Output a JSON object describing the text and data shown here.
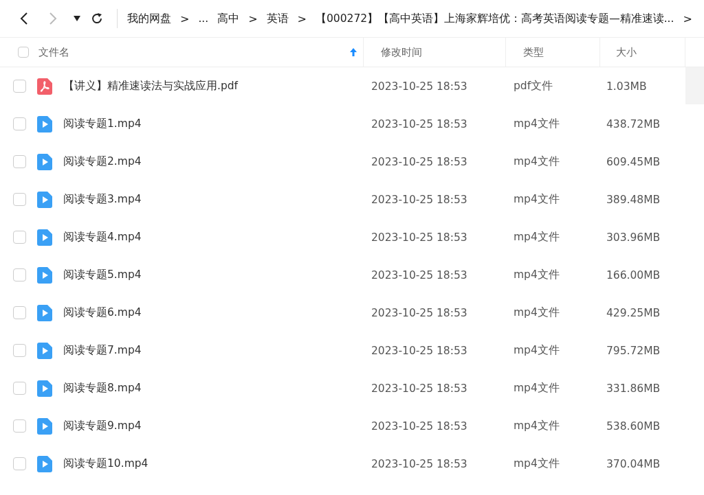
{
  "toolbar": {
    "back": {
      "disabled": false
    },
    "forward": {
      "disabled": true
    },
    "breadcrumbs": [
      {
        "label": "我的网盘",
        "kind": "crumb"
      },
      {
        "label": "...",
        "kind": "ellipsis"
      },
      {
        "label": "高中",
        "kind": "crumb"
      },
      {
        "label": "英语",
        "kind": "crumb"
      },
      {
        "label": "【000272】【高中英语】上海家辉培优：高考英语阅读专题—精准速读...",
        "kind": "crumb"
      }
    ],
    "separator": ">"
  },
  "table": {
    "select_all": {
      "checked": false
    },
    "columns": [
      {
        "label": "文件名",
        "sorted": true
      },
      {
        "label": "修改时间",
        "sorted": false
      },
      {
        "label": "类型",
        "sorted": false
      },
      {
        "label": "大小",
        "sorted": false
      }
    ],
    "rows": [
      {
        "kind": "pdf",
        "checked": false,
        "name": "【讲义】精准速读法与实战应用.pdf",
        "modified": "2023-10-25 18:53",
        "type": "pdf文件",
        "size": "1.03MB"
      },
      {
        "kind": "video",
        "checked": false,
        "name": "阅读专题1.mp4",
        "modified": "2023-10-25 18:53",
        "type": "mp4文件",
        "size": "438.72MB"
      },
      {
        "kind": "video",
        "checked": false,
        "name": "阅读专题2.mp4",
        "modified": "2023-10-25 18:53",
        "type": "mp4文件",
        "size": "609.45MB"
      },
      {
        "kind": "video",
        "checked": false,
        "name": "阅读专题3.mp4",
        "modified": "2023-10-25 18:53",
        "type": "mp4文件",
        "size": "389.48MB"
      },
      {
        "kind": "video",
        "checked": false,
        "name": "阅读专题4.mp4",
        "modified": "2023-10-25 18:53",
        "type": "mp4文件",
        "size": "303.96MB"
      },
      {
        "kind": "video",
        "checked": false,
        "name": "阅读专题5.mp4",
        "modified": "2023-10-25 18:53",
        "type": "mp4文件",
        "size": "166.00MB"
      },
      {
        "kind": "video",
        "checked": false,
        "name": "阅读专题6.mp4",
        "modified": "2023-10-25 18:53",
        "type": "mp4文件",
        "size": "429.25MB"
      },
      {
        "kind": "video",
        "checked": false,
        "name": "阅读专题7.mp4",
        "modified": "2023-10-25 18:53",
        "type": "mp4文件",
        "size": "795.72MB"
      },
      {
        "kind": "video",
        "checked": false,
        "name": "阅读专题8.mp4",
        "modified": "2023-10-25 18:53",
        "type": "mp4文件",
        "size": "331.86MB"
      },
      {
        "kind": "video",
        "checked": false,
        "name": "阅读专题9.mp4",
        "modified": "2023-10-25 18:53",
        "type": "mp4文件",
        "size": "538.60MB"
      },
      {
        "kind": "video",
        "checked": false,
        "name": "阅读专题10.mp4",
        "modified": "2023-10-25 18:53",
        "type": "mp4文件",
        "size": "370.04MB"
      }
    ]
  }
}
